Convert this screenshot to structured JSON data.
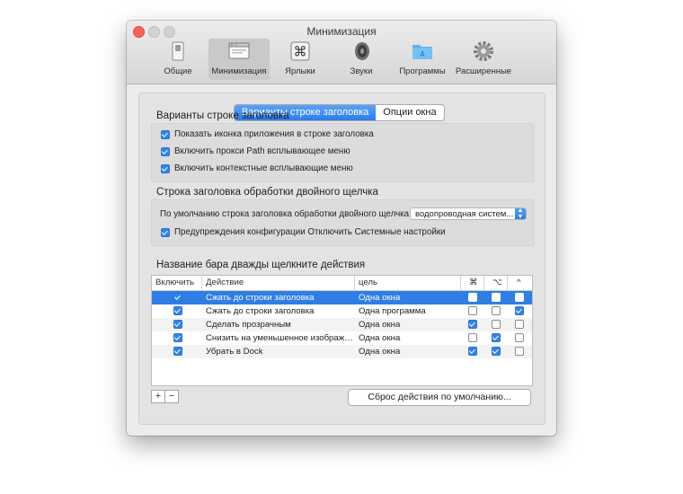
{
  "window": {
    "title": "Минимизация"
  },
  "toolbar": {
    "items": [
      {
        "label": "Общие",
        "icon": "switch-icon"
      },
      {
        "label": "Минимизация",
        "icon": "window-icon",
        "active": true
      },
      {
        "label": "Ярлыки",
        "icon": "command-key-icon"
      },
      {
        "label": "Звуки",
        "icon": "speaker-icon"
      },
      {
        "label": "Программы",
        "icon": "applications-folder-icon"
      },
      {
        "label": "Расширенные",
        "icon": "gear-icon"
      }
    ]
  },
  "tabs": [
    {
      "label": "Варианты строке заголовка",
      "active": true
    },
    {
      "label": "Опции окна",
      "active": false
    }
  ],
  "titlebar_options": {
    "title": "Варианты строке заголовка",
    "items": [
      {
        "label": "Показать иконка приложения в строке заголовка",
        "checked": true
      },
      {
        "label": "Включить прокси Path всплывающее меню",
        "checked": true
      },
      {
        "label": "Включить контекстные всплывающие меню",
        "checked": true
      }
    ]
  },
  "double_click": {
    "title": "Строка заголовка обработки двойного щелчка",
    "default_label": "По умолчанию строка заголовка обработки двойного щелчка",
    "default_value": "водопроводная систем...",
    "warning_label": "Предупреждения конфигурации Отключить Системные настройки",
    "warning_checked": true
  },
  "actions": {
    "title": "Название бара дважды щелкните действия",
    "columns": [
      "Включить",
      "Действие",
      "цель",
      "⌘",
      "⌥",
      "^"
    ],
    "rows": [
      {
        "enabled": true,
        "action": "Сжать до строки заголовка",
        "target": "Одна окна",
        "cmd": false,
        "opt": false,
        "ctrl": false,
        "selected": true
      },
      {
        "enabled": true,
        "action": "Сжать до строки заголовка",
        "target": "Одна программа",
        "cmd": false,
        "opt": false,
        "ctrl": true,
        "selected": false
      },
      {
        "enabled": true,
        "action": "Сделать прозрачным",
        "target": "Одна окна",
        "cmd": true,
        "opt": false,
        "ctrl": false,
        "selected": false
      },
      {
        "enabled": true,
        "action": "Снизить на уменьшенное изображ…",
        "target": "Одна окна",
        "cmd": false,
        "opt": true,
        "ctrl": false,
        "selected": false
      },
      {
        "enabled": true,
        "action": "Убрать в Dock",
        "target": "Одна окна",
        "cmd": true,
        "opt": true,
        "ctrl": false,
        "selected": false
      }
    ],
    "add_label": "+",
    "remove_label": "−",
    "reset_label": "Сброс действия по умолчанию..."
  },
  "colors": {
    "accent": "#2f7ee6",
    "close": "#fc605c"
  }
}
